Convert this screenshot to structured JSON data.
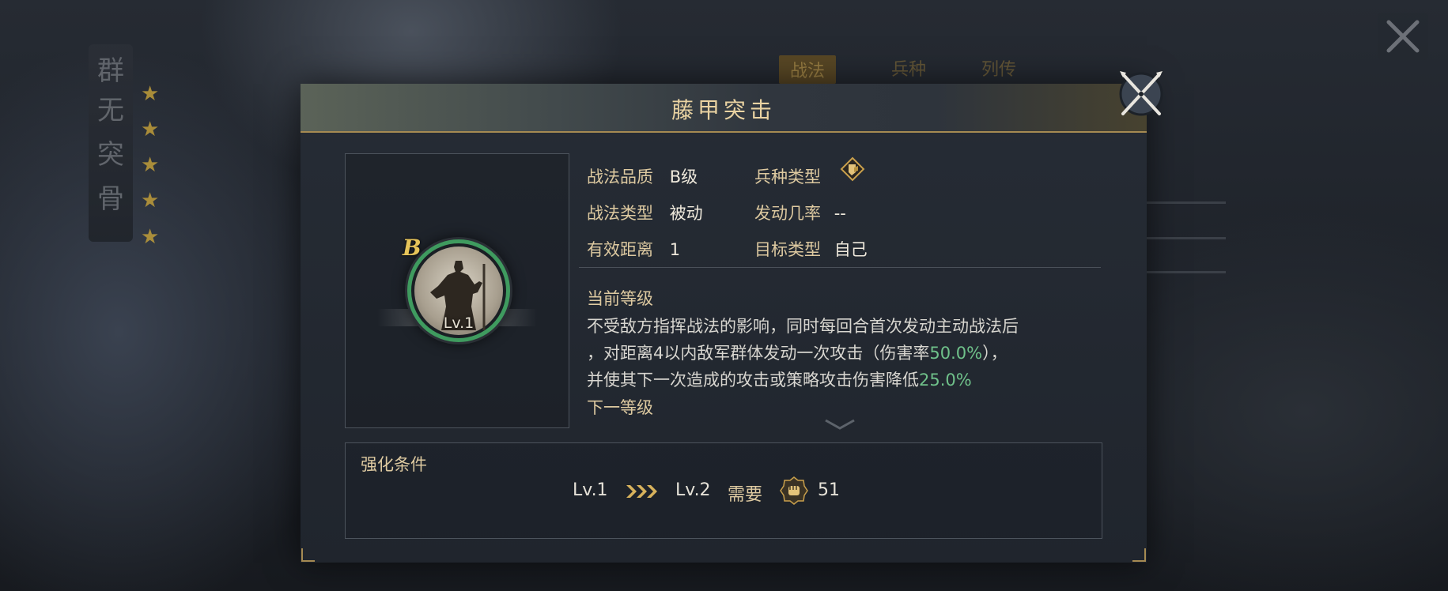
{
  "background": {
    "banner_chars": [
      "群",
      "无",
      "突",
      "骨"
    ],
    "stars": 5,
    "tabs": [
      "战法",
      "兵种",
      "列传"
    ],
    "active_tab": 0
  },
  "dialog": {
    "title": "藤甲突击",
    "portrait": {
      "grade": "B",
      "level": "Lv.1"
    },
    "info": {
      "quality_label": "战法品质",
      "quality_value": "B级",
      "troop_label": "兵种类型",
      "troop_icon": "shield-troop-icon",
      "type_label": "战法类型",
      "type_value": "被动",
      "rate_label": "发动几率",
      "rate_value": "--",
      "range_label": "有效距离",
      "range_value": "1",
      "target_label": "目标类型",
      "target_value": "自己"
    },
    "current_level_title": "当前等级",
    "description": {
      "line1": "不受敌方指挥战法的影响，同时每回合首次发动主动战法后",
      "line2_a": "，对距离4以内敌军群体发动一次攻击（伤害率",
      "line2_pct": "50.0%",
      "line2_b": "），",
      "line3_a": "并使其下一次造成的攻击或策略攻击伤害降低",
      "line3_pct": "25.0%"
    },
    "next_level_title": "下一等级",
    "upgrade": {
      "title": "强化条件",
      "from_level": "Lv.1",
      "to_level": "Lv.2",
      "require_label": "需要",
      "cost_icon": "fist-token-icon",
      "cost_value": "51"
    }
  },
  "colors": {
    "accent_gold": "#ddc9a0",
    "highlight_green": "#6fc18a",
    "ring_green": "#3f9b5f"
  }
}
